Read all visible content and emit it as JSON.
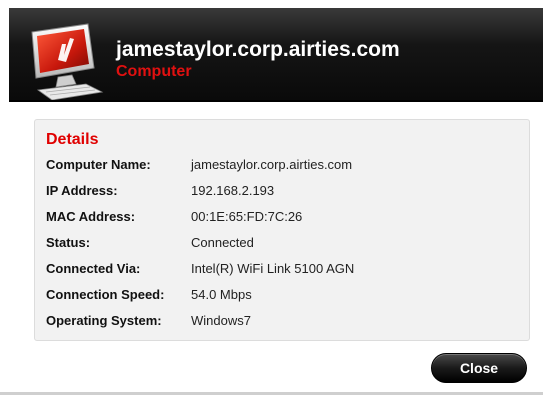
{
  "header": {
    "title": "jamestaylor.corp.airties.com",
    "subtitle": "Computer",
    "icon": "computer-icon"
  },
  "details": {
    "heading": "Details",
    "rows": [
      {
        "label": "Computer Name:",
        "value": "jamestaylor.corp.airties.com"
      },
      {
        "label": "IP Address:",
        "value": "192.168.2.193"
      },
      {
        "label": "MAC Address:",
        "value": "00:1E:65:FD:7C:26"
      },
      {
        "label": "Status:",
        "value": "Connected"
      },
      {
        "label": "Connected Via:",
        "value": "Intel(R) WiFi Link 5100 AGN"
      },
      {
        "label": "Connection Speed:",
        "value": "54.0 Mbps"
      },
      {
        "label": "Operating System:",
        "value": "Windows7"
      }
    ]
  },
  "actions": {
    "close_label": "Close"
  },
  "colors": {
    "accent_red": "#e00000",
    "header_bg": "#111111",
    "panel_bg": "#f2f2f2"
  }
}
